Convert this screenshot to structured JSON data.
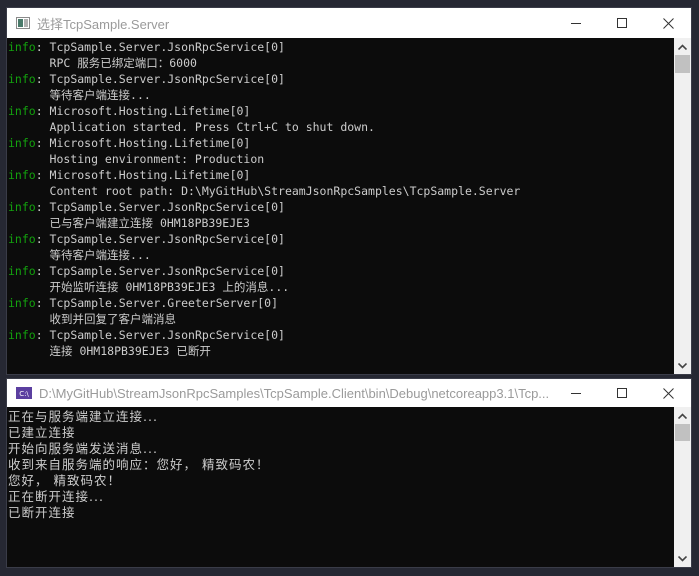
{
  "server_window": {
    "title": "选择TcpSample.Server",
    "icon": "console-window-icon",
    "controls": {
      "minimize": "minimize-icon",
      "maximize": "maximize-icon",
      "close": "close-icon"
    },
    "lines": [
      {
        "level": "info",
        "text": ": TcpSample.Server.JsonRpcService[0]"
      },
      {
        "level": "",
        "text": "      RPC 服务已绑定端口：6000"
      },
      {
        "level": "info",
        "text": ": TcpSample.Server.JsonRpcService[0]"
      },
      {
        "level": "",
        "text": "      等待客户端连接..."
      },
      {
        "level": "info",
        "text": ": Microsoft.Hosting.Lifetime[0]"
      },
      {
        "level": "",
        "text": "      Application started. Press Ctrl+C to shut down."
      },
      {
        "level": "info",
        "text": ": Microsoft.Hosting.Lifetime[0]"
      },
      {
        "level": "",
        "text": "      Hosting environment: Production"
      },
      {
        "level": "info",
        "text": ": Microsoft.Hosting.Lifetime[0]"
      },
      {
        "level": "",
        "text": "      Content root path: D:\\MyGitHub\\StreamJsonRpcSamples\\TcpSample.Server"
      },
      {
        "level": "info",
        "text": ": TcpSample.Server.JsonRpcService[0]"
      },
      {
        "level": "",
        "text": "      已与客户端建立连接 0HM18PB39EJE3"
      },
      {
        "level": "info",
        "text": ": TcpSample.Server.JsonRpcService[0]"
      },
      {
        "level": "",
        "text": "      等待客户端连接..."
      },
      {
        "level": "info",
        "text": ": TcpSample.Server.JsonRpcService[0]"
      },
      {
        "level": "",
        "text": "      开始监听连接 0HM18PB39EJE3 上的消息..."
      },
      {
        "level": "info",
        "text": ": TcpSample.Server.GreeterServer[0]"
      },
      {
        "level": "",
        "text": "      收到并回复了客户端消息"
      },
      {
        "level": "info",
        "text": ": TcpSample.Server.JsonRpcService[0]"
      },
      {
        "level": "",
        "text": "      连接 0HM18PB39EJE3 已断开"
      }
    ],
    "scroll_position": 0
  },
  "client_window": {
    "title": "D:\\MyGitHub\\StreamJsonRpcSamples\\TcpSample.Client\\bin\\Debug\\netcoreapp3.1\\Tcp...",
    "icon": "cmd-icon",
    "controls": {
      "minimize": "minimize-icon",
      "maximize": "maximize-icon",
      "close": "close-icon"
    },
    "lines": [
      "正在与服务端建立连接...",
      "已建立连接",
      "开始向服务端发送消息...",
      "收到来自服务端的响应：您好， 精致码农！",
      "您好， 精致码农！",
      "正在断开连接...",
      "已断开连接"
    ],
    "scroll_position": 0
  },
  "colors": {
    "info": "#13a10e",
    "text": "#cccccc",
    "console_bg": "#0c0c0c",
    "desktop_bg": "#262833"
  }
}
